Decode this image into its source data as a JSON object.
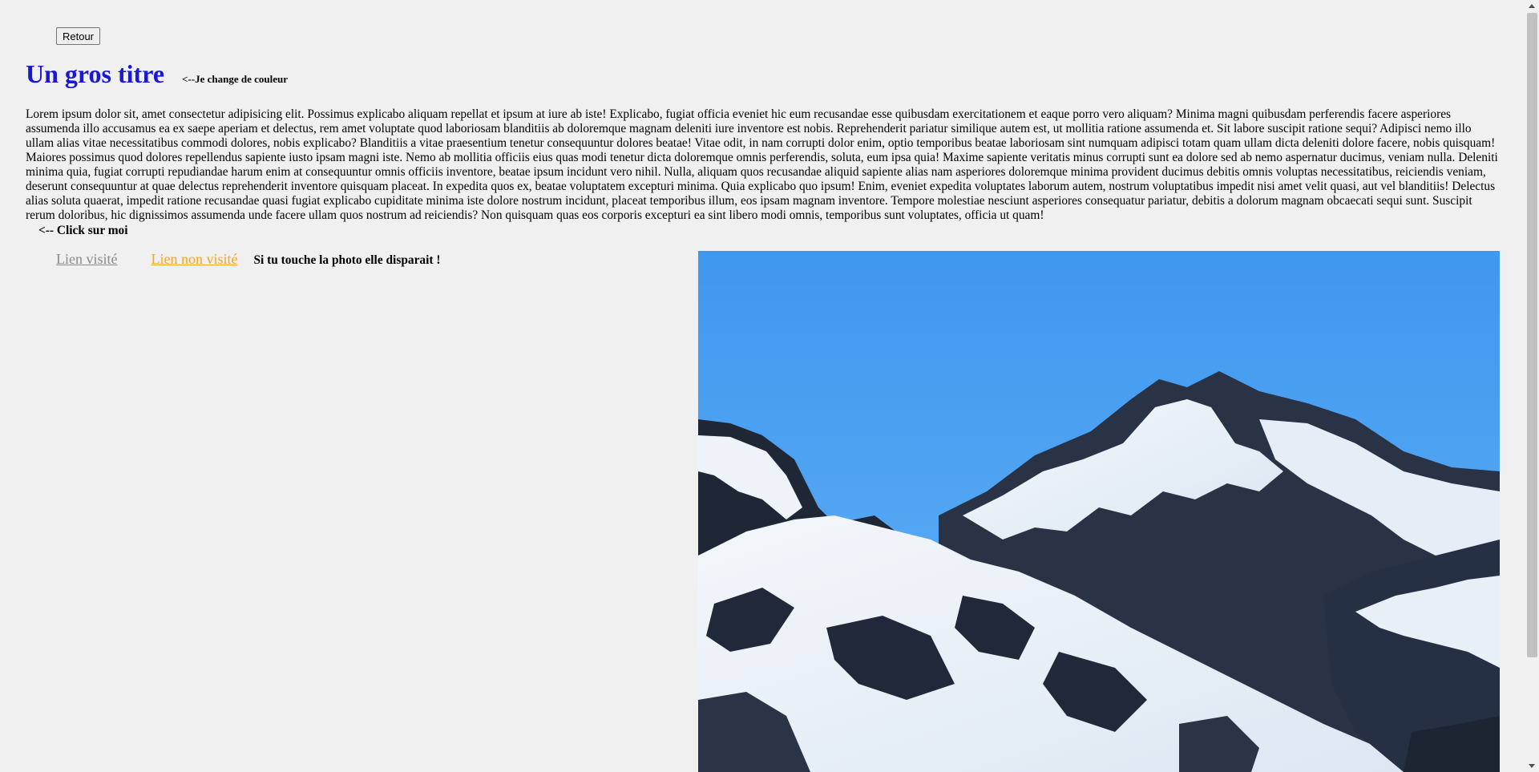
{
  "buttons": {
    "back_label": "Retour"
  },
  "header": {
    "title": "Un gros titre",
    "color_note": "<--Je change de couleur",
    "title_color": "#1a17d6"
  },
  "content": {
    "paragraph": "Lorem ipsum dolor sit, amet consectetur adipisicing elit. Possimus explicabo aliquam repellat et ipsum at iure ab iste! Explicabo, fugiat officia eveniet hic eum recusandae esse quibusdam exercitationem et eaque porro vero aliquam? Minima magni quibusdam perferendis facere asperiores assumenda illo accusamus ea ex saepe aperiam et delectus, rem amet voluptate quod laboriosam blanditiis ab doloremque magnam deleniti iure inventore est nobis. Reprehenderit pariatur similique autem est, ut mollitia ratione assumenda et. Sit labore suscipit ratione sequi? Adipisci nemo illo ullam alias vitae necessitatibus commodi dolores, nobis explicabo? Blanditiis a vitae praesentium tenetur consequuntur dolores beatae! Vitae odit, in nam corrupti dolor enim, optio temporibus beatae laboriosam sint numquam adipisci totam quam ullam dicta deleniti dolore facere, nobis quisquam! Maiores possimus quod dolores repellendus sapiente iusto ipsam magni iste. Nemo ab mollitia officiis eius quas modi tenetur dicta doloremque omnis perferendis, soluta, eum ipsa quia! Maxime sapiente veritatis minus corrupti sunt ea dolore sed ab nemo aspernatur ducimus, veniam nulla. Deleniti minima quia, fugiat corrupti repudiandae harum enim at consequuntur omnis officiis inventore, beatae ipsum incidunt vero nihil. Nulla, aliquam quos recusandae aliquid sapiente alias nam asperiores doloremque minima provident ducimus debitis omnis voluptas necessitatibus, reiciendis veniam, deserunt consequuntur at quae delectus reprehenderit inventore quisquam placeat. In expedita quos ex, beatae voluptatem excepturi minima. Quia explicabo quo ipsum! Enim, eveniet expedita voluptates laborum autem, nostrum voluptatibus impedit nisi amet velit quasi, aut vel blanditiis! Delectus alias soluta quaerat, impedit ratione recusandae quasi fugiat explicabo cupiditate minima iste dolore nostrum incidunt, placeat temporibus illum, eos ipsam magnam inventore. Tempore molestiae nesciunt asperiores consequatur pariatur, debitis a dolorum magnam obcaecati sequi sunt. Suscipit rerum doloribus, hic dignissimos assumenda unde facere ullam quos nostrum ad reiciendis? Non quisquam quas eos corporis excepturi ea sint libero modi omnis, temporibus sunt voluptates, officia ut quam!",
    "click_me": "<-- Click sur moi"
  },
  "links": {
    "visited": "Lien visité",
    "unvisited": "Lien non visité",
    "visited_color": "#8a8a8a",
    "unvisited_color": "#f5a623",
    "photo_note": "Si tu touche la photo elle disparait !"
  },
  "image": {
    "subject": "snowy-mountain-photo",
    "sky_color": "#4a9ef0"
  }
}
